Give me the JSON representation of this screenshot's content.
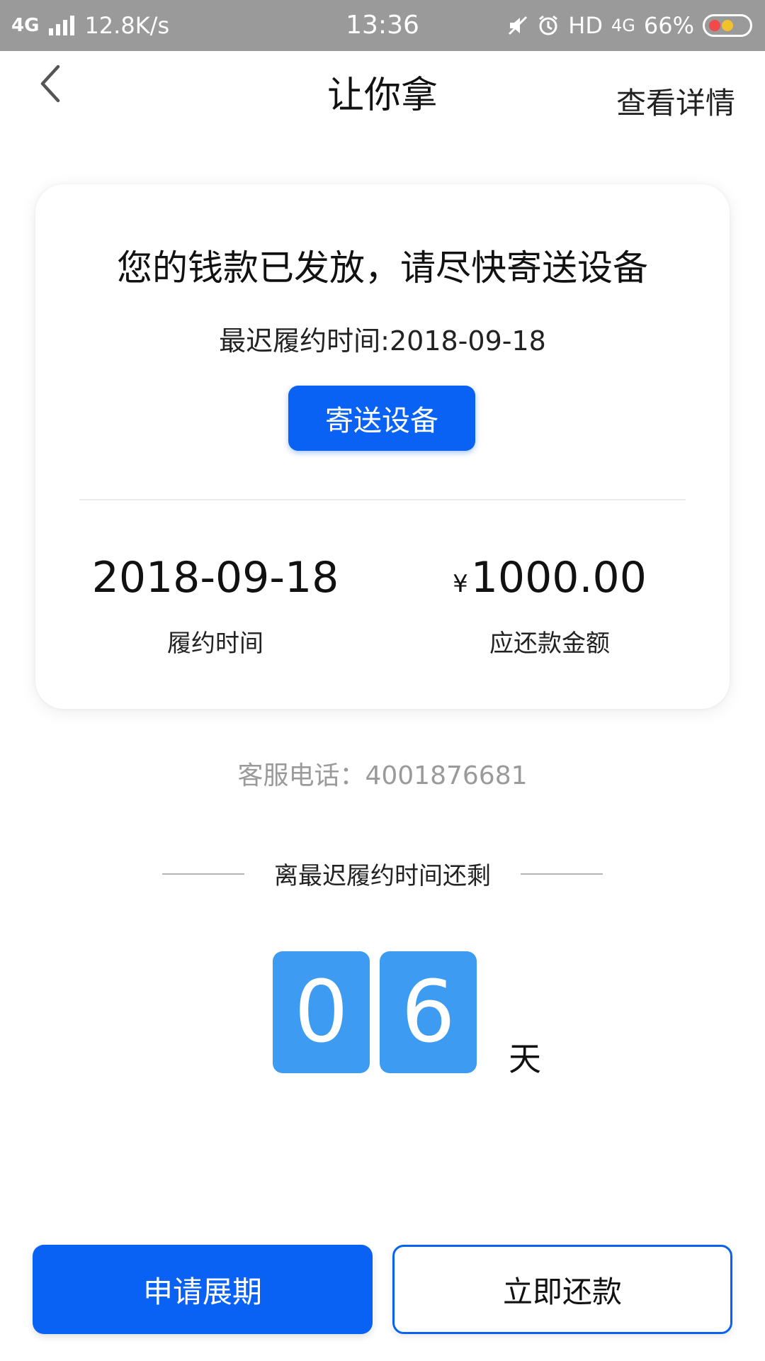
{
  "status_bar": {
    "network_type": "4G",
    "speed": "12.8K/s",
    "time": "13:36",
    "hd_label": "HD",
    "net_badge": "4G",
    "battery": "66%",
    "icons": [
      "signal-icon",
      "mute-icon",
      "alarm-icon",
      "battery-icon"
    ]
  },
  "header": {
    "title": "让你拿",
    "detail_link": "查看详情",
    "back_icon": "chevron-left-icon"
  },
  "card": {
    "headline": "您的钱款已发放，请尽快寄送设备",
    "deadline_text": "最迟履约时间:2018-09-18",
    "ship_button": "寄送设备",
    "due_date": "2018-09-18",
    "due_date_label": "履约时间",
    "currency_symbol": "¥",
    "amount": "1000.00",
    "amount_label": "应还款金额"
  },
  "service": {
    "phone_text": "客服电话：4001876681"
  },
  "countdown": {
    "label": "离最迟履约时间还剩",
    "digits": [
      "0",
      "6"
    ],
    "unit": "天"
  },
  "actions": {
    "extend_label": "申请展期",
    "repay_label": "立即还款"
  },
  "colors": {
    "primary": "#0a62f5",
    "digit_bg": "#3d9bf2",
    "status_bar_bg": "#9a9a9a",
    "muted_text": "#9a9a9a"
  }
}
